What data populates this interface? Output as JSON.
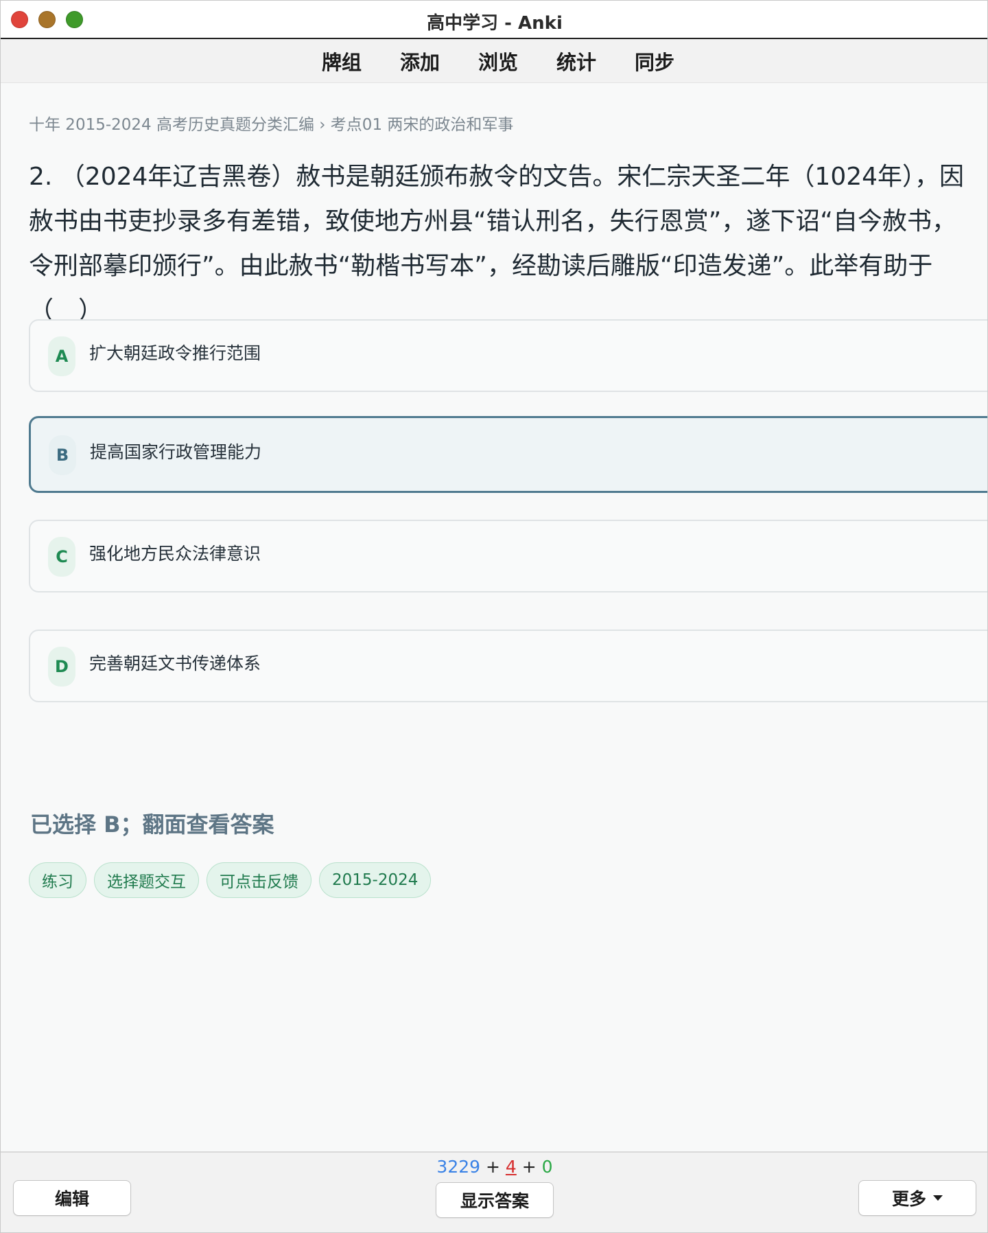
{
  "window": {
    "title": "高中学习 - Anki"
  },
  "topnav": {
    "items": [
      "牌组",
      "添加",
      "浏览",
      "统计",
      "同步"
    ]
  },
  "card": {
    "breadcrumb": "十年 2015-2024 高考历史真题分类汇编 › 考点01 两宋的政治和军事",
    "question": "2. （2024年辽吉黑卷）赦书是朝廷颁布赦令的文告。宋仁宗天圣二年（1024年），因赦书由书吏抄录多有差错，致使地方州县“错认刑名，失行恩赏”，遂下诏“自今赦书，令刑部摹印颁行”。由此赦书“勒楷书写本”，经勘读后雕版“印造发递”。此举有助于（　）",
    "options": [
      {
        "letter": "A",
        "text": "扩大朝廷政令推行范围"
      },
      {
        "letter": "B",
        "text": "提高国家行政管理能力"
      },
      {
        "letter": "C",
        "text": "强化地方民众法律意识"
      },
      {
        "letter": "D",
        "text": "完善朝廷文书传递体系"
      }
    ],
    "selected_note": "已选择 B；翻面查看答案",
    "tags": [
      "练习",
      "选择题交互",
      "可点击反馈",
      "2015-2024"
    ]
  },
  "bottombar": {
    "count_new": "3229",
    "count_learn": "4",
    "count_review": "0",
    "plus": "+",
    "edit_label": "编辑",
    "show_answer_label": "显示答案",
    "more_label": "更多"
  },
  "colors": {
    "accent_green": "#1e8a52",
    "selected_border": "#4f7a8f",
    "new_count": "#3a82e6",
    "learn_count": "#d62d2d",
    "review_count": "#2aa845"
  }
}
